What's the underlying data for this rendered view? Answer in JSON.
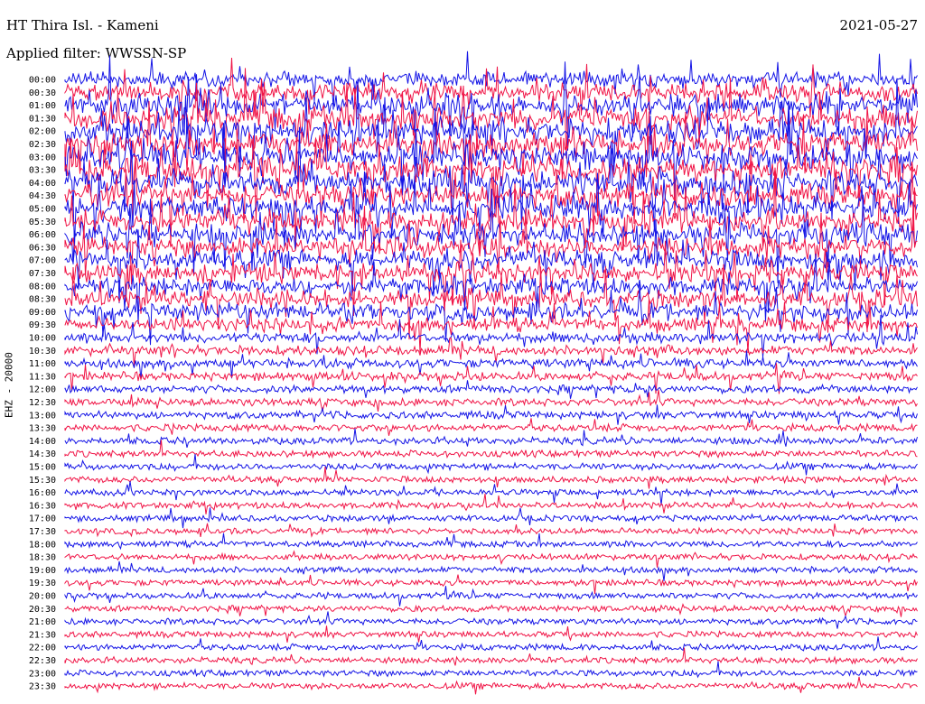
{
  "header": {
    "station_title": "HT Thira Isl. - Kameni",
    "date": "2021-05-27",
    "filter": "Applied filter: WWSSN-SP",
    "channel_label": "EHZ - 20000"
  },
  "colors": {
    "blue": "#1414e6",
    "red": "#f01446"
  },
  "chart_data": {
    "type": "helicorder",
    "title": "HT Thira Isl. - Kameni",
    "date": "2021-05-27",
    "ylabel": "EHZ - 20000",
    "rows": [
      "00:00",
      "00:30",
      "01:00",
      "01:30",
      "02:00",
      "02:30",
      "03:00",
      "03:30",
      "04:00",
      "04:30",
      "05:00",
      "05:30",
      "06:00",
      "06:30",
      "07:00",
      "07:30",
      "08:00",
      "08:30",
      "09:00",
      "09:30",
      "10:00",
      "10:30",
      "11:00",
      "11:30",
      "12:00",
      "12:30",
      "13:00",
      "13:30",
      "14:00",
      "14:30",
      "15:00",
      "15:30",
      "16:00",
      "16:30",
      "17:00",
      "17:30",
      "18:00",
      "18:30",
      "19:00",
      "19:30",
      "20:00",
      "20:30",
      "21:00",
      "21:30",
      "22:00",
      "22:30",
      "23:00",
      "23:30"
    ],
    "trace_colors": [
      "blue",
      "red"
    ],
    "activity": [
      [
        0.55,
        0.7,
        0.85,
        1.0,
        1.0,
        1.0,
        1.0,
        1.0,
        1.0,
        0.95,
        0.95,
        0.9,
        0.9,
        0.85,
        0.8,
        0.75,
        0.7,
        0.7,
        0.65,
        0.5,
        0.35,
        0.3,
        0.28,
        0.25,
        0.22,
        0.2,
        0.2,
        0.18,
        0.18,
        0.16,
        0.15,
        0.14,
        0.14,
        0.14,
        0.13,
        0.13,
        0.13,
        0.13,
        0.13,
        0.13,
        0.13,
        0.13,
        0.13,
        0.13,
        0.13,
        0.13,
        0.13,
        0.13
      ]
    ]
  }
}
